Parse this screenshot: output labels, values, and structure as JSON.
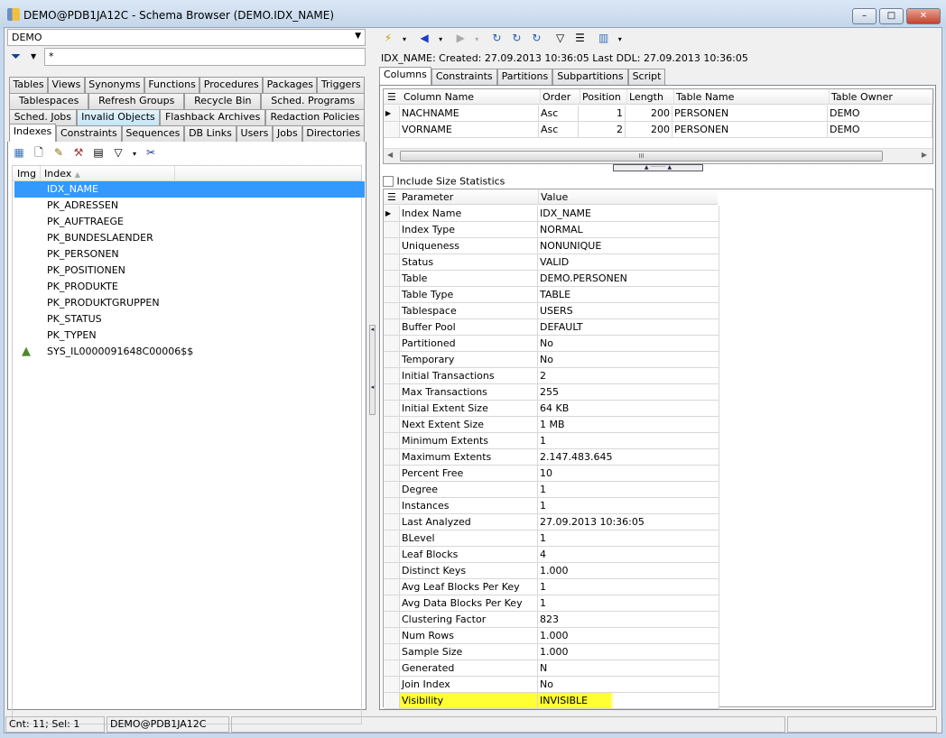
{
  "window": {
    "title": "DEMO@PDB1JA12C - Schema Browser (DEMO.IDX_NAME)",
    "minimize": "–",
    "maximize": "□",
    "close": "✕"
  },
  "left": {
    "schema": "DEMO",
    "filter_value": "*",
    "tab_rows": [
      [
        "Tables",
        "Views",
        "Synonyms",
        "Functions",
        "Procedures",
        "Packages",
        "Triggers"
      ],
      [
        "Tablespaces",
        "Refresh Groups",
        "Recycle Bin",
        "Sched. Programs"
      ],
      [
        "Sched. Jobs",
        "Invalid Objects",
        "Flashback Archives",
        "Redaction Policies"
      ],
      [
        "Indexes",
        "Constraints",
        "Sequences",
        "DB Links",
        "Users",
        "Jobs",
        "Directories"
      ]
    ],
    "highlighted_tab": "Invalid Objects",
    "active_tab": "Indexes",
    "list_headers": {
      "img": "Img",
      "index": "Index"
    },
    "items": [
      "IDX_NAME",
      "PK_ADRESSEN",
      "PK_AUFTRAEGE",
      "PK_BUNDESLAENDER",
      "PK_PERSONEN",
      "PK_POSITIONEN",
      "PK_PRODUKTE",
      "PK_PRODUKTGRUPPEN",
      "PK_STATUS",
      "PK_TYPEN",
      "SYS_IL0000091648C00006$$"
    ],
    "selected": "IDX_NAME"
  },
  "right": {
    "info": "IDX_NAME:  Created: 27.09.2013 10:36:05  Last DDL: 27.09.2013 10:36:05",
    "tabs": [
      "Columns",
      "Constraints",
      "Partitions",
      "Subpartitions",
      "Script"
    ],
    "active_tab": "Columns",
    "columns": {
      "headers": [
        "Column Name",
        "Order",
        "Position",
        "Length",
        "Table Name",
        "Table Owner"
      ],
      "rows": [
        [
          "NACHNAME",
          "Asc",
          "1",
          "200",
          "PERSONEN",
          "DEMO"
        ],
        [
          "VORNAME",
          "Asc",
          "2",
          "200",
          "PERSONEN",
          "DEMO"
        ]
      ]
    },
    "scroll_mark": "III",
    "include_size_statistics": {
      "label": "Include Size Statistics",
      "checked": false
    },
    "params": {
      "headers": [
        "Parameter",
        "Value"
      ],
      "rows": [
        [
          "Index Name",
          "IDX_NAME"
        ],
        [
          "Index Type",
          "NORMAL"
        ],
        [
          "Uniqueness",
          "NONUNIQUE"
        ],
        [
          "Status",
          "VALID"
        ],
        [
          "Table",
          "DEMO.PERSONEN"
        ],
        [
          "Table Type",
          "TABLE"
        ],
        [
          "Tablespace",
          "USERS"
        ],
        [
          "Buffer Pool",
          "DEFAULT"
        ],
        [
          "Partitioned",
          "No"
        ],
        [
          "Temporary",
          "No"
        ],
        [
          "Initial Transactions",
          "2"
        ],
        [
          "Max Transactions",
          "255"
        ],
        [
          "Initial Extent Size",
          "64 KB"
        ],
        [
          "Next Extent Size",
          "1 MB"
        ],
        [
          "Minimum Extents",
          "1"
        ],
        [
          "Maximum Extents",
          "2.147.483.645"
        ],
        [
          "Percent Free",
          "10"
        ],
        [
          "Degree",
          "1"
        ],
        [
          "Instances",
          "1"
        ],
        [
          "Last Analyzed",
          "27.09.2013 10:36:05"
        ],
        [
          "BLevel",
          "1"
        ],
        [
          "Leaf Blocks",
          "4"
        ],
        [
          "Distinct Keys",
          "1.000"
        ],
        [
          "Avg Leaf Blocks Per Key",
          "1"
        ],
        [
          "Avg Data Blocks Per Key",
          "1"
        ],
        [
          "Clustering Factor",
          "823"
        ],
        [
          "Num Rows",
          "1.000"
        ],
        [
          "Sample Size",
          "1.000"
        ],
        [
          "Generated",
          "N"
        ],
        [
          "Join Index",
          "No"
        ],
        [
          "Visibility",
          "INVISIBLE"
        ]
      ],
      "highlighted_row": "Visibility",
      "highlight_color": "#ffff33"
    }
  },
  "status": {
    "count": "Cnt: 11;  Sel: 1",
    "connection": "DEMO@PDB1JA12C"
  },
  "colors": {
    "selection": "#3399ff",
    "tab_highlight": "#c4e5f6"
  }
}
